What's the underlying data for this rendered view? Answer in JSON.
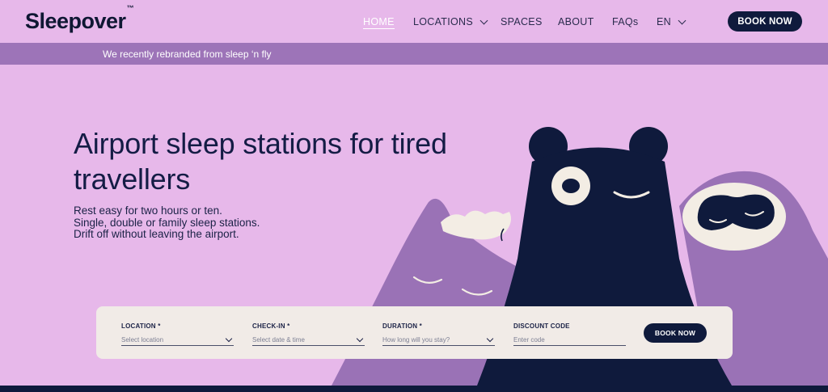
{
  "brand": {
    "logo": "Sleepover",
    "trademark": "™"
  },
  "nav": {
    "items": [
      {
        "label": "HOME",
        "active": true,
        "dropdown": false
      },
      {
        "label": "LOCATIONS",
        "active": false,
        "dropdown": true
      },
      {
        "label": "SPACES",
        "active": false,
        "dropdown": false
      },
      {
        "label": "ABOUT",
        "active": false,
        "dropdown": false
      },
      {
        "label": "FAQs",
        "active": false,
        "dropdown": false
      },
      {
        "label": "EN",
        "active": false,
        "dropdown": true
      }
    ],
    "book_label": "BOOK NOW"
  },
  "banner": {
    "text": "We recently rebranded from sleep ‘n fly"
  },
  "hero": {
    "title": "Airport sleep stations for tired travellers",
    "subtitle_lines": [
      "Rest easy for two hours or ten.",
      "Single, double or family sleep stations.",
      "Drift off without leaving the airport."
    ]
  },
  "booking": {
    "fields": [
      {
        "label": "LOCATION *",
        "placeholder": "Select location",
        "dropdown": true
      },
      {
        "label": "CHECK-IN *",
        "placeholder": "Select date & time",
        "dropdown": true
      },
      {
        "label": "DURATION *",
        "placeholder": "How long will you stay?",
        "dropdown": true
      },
      {
        "label": "DISCOUNT CODE",
        "placeholder": "Enter code",
        "dropdown": false
      }
    ],
    "book_label": "BOOK NOW"
  },
  "colors": {
    "background": "#e7b8ea",
    "banner": "#9d74b8",
    "navy": "#0f1a3c",
    "form_bg": "#f1ebe7",
    "purple_shape": "#9a72b6",
    "cream": "#f3ede4"
  }
}
